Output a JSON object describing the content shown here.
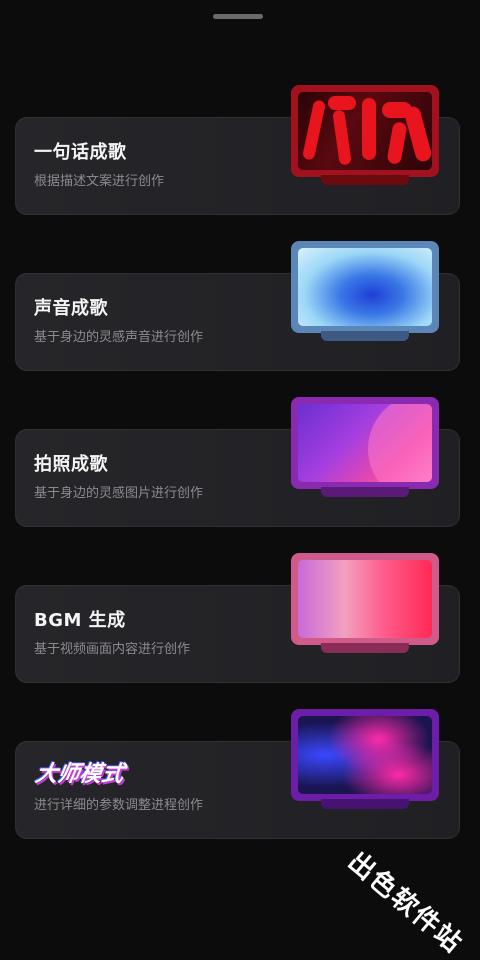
{
  "cards": [
    {
      "title": "一句话成歌",
      "subtitle": "根据描述文案进行创作"
    },
    {
      "title": "声音成歌",
      "subtitle": "基于身边的灵感声音进行创作"
    },
    {
      "title": "拍照成歌",
      "subtitle": "基于身边的灵感图片进行创作"
    },
    {
      "title": "BGM 生成",
      "subtitle": "基于视频画面内容进行创作"
    },
    {
      "title": "大师模式",
      "subtitle": "进行详细的参数调整进程创作"
    }
  ],
  "watermark": "出色软件站"
}
